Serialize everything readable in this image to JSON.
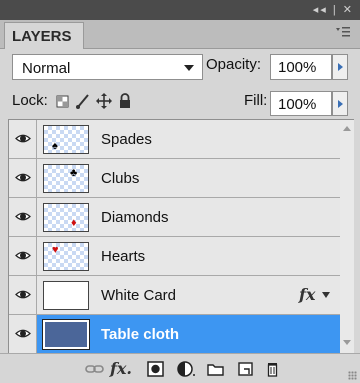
{
  "panel": {
    "title": "LAYERS",
    "top_controls": "◂◂ | ✕"
  },
  "blend": {
    "mode": "Normal",
    "opacity_label": "Opacity:",
    "opacity_value": "100%"
  },
  "lock": {
    "label": "Lock:",
    "fill_label": "Fill:",
    "fill_value": "100%"
  },
  "layers": [
    {
      "name": "Spades",
      "suit": "♠",
      "suit_color": "#000000",
      "visible": true,
      "selected": false
    },
    {
      "name": "Clubs",
      "suit": "♣",
      "suit_color": "#000000",
      "visible": true,
      "selected": false
    },
    {
      "name": "Diamonds",
      "suit": "♦",
      "suit_color": "#d01010",
      "visible": true,
      "selected": false
    },
    {
      "name": "Hearts",
      "suit": "♥",
      "suit_color": "#d01010",
      "visible": true,
      "selected": false
    },
    {
      "name": "White Card",
      "visible": true,
      "selected": false,
      "has_fx": true,
      "fx_label": "fx"
    },
    {
      "name": "Table cloth",
      "visible": true,
      "selected": true
    }
  ],
  "colors": {
    "selection": "#3d96f2",
    "table_cloth": "#4b6699",
    "panel_bg": "#d6d6d6"
  },
  "toolbar_icons": [
    "link-layers-icon",
    "layer-style-fx-icon",
    "add-mask-icon",
    "adjustment-layer-icon",
    "new-group-folder-icon",
    "new-layer-icon",
    "delete-trash-icon"
  ],
  "toolbar_fx_label": "fx."
}
